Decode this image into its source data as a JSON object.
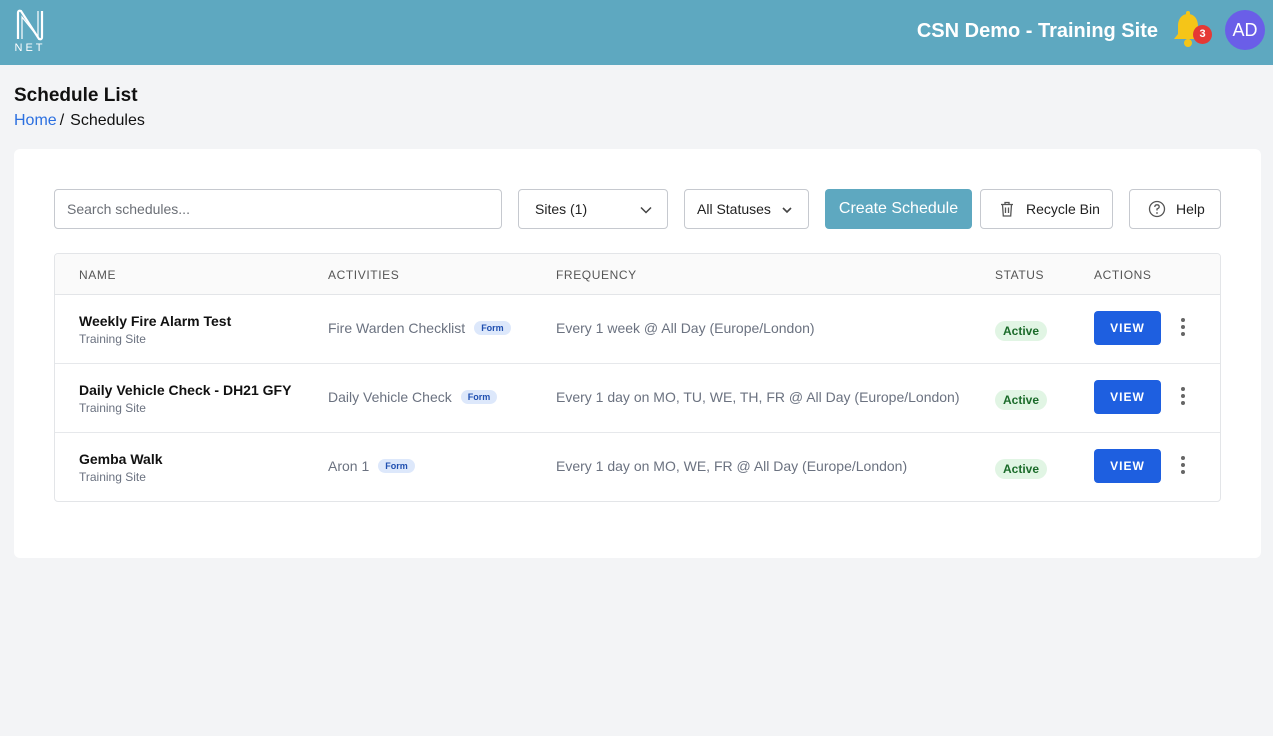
{
  "header": {
    "logo_text": "NET",
    "site_title": "CSN Demo - Training Site",
    "notification_count": "3",
    "avatar_initials": "AD"
  },
  "page": {
    "title": "Schedule List",
    "breadcrumb": {
      "home": "Home",
      "separator": "/",
      "current": "Schedules"
    }
  },
  "toolbar": {
    "search_placeholder": "Search schedules...",
    "sites_filter": "Sites (1)",
    "status_filter": "All Statuses",
    "create_label": "Create Schedule",
    "recycle_label": "Recycle Bin",
    "help_label": "Help"
  },
  "table": {
    "columns": [
      "NAME",
      "ACTIVITIES",
      "FREQUENCY",
      "STATUS",
      "ACTIONS"
    ],
    "rows": [
      {
        "name": "Weekly Fire Alarm Test",
        "site": "Training Site",
        "activity": "Fire Warden Checklist",
        "activity_tag": "Form",
        "frequency": "Every 1 week @ All Day (Europe/London)",
        "status": "Active",
        "action": "VIEW"
      },
      {
        "name": "Daily Vehicle Check - DH21 GFY",
        "site": "Training Site",
        "activity": "Daily Vehicle Check",
        "activity_tag": "Form",
        "frequency": "Every 1 day on MO, TU, WE, TH, FR @ All Day (Europe/London)",
        "status": "Active",
        "action": "VIEW"
      },
      {
        "name": "Gemba Walk",
        "site": "Training Site",
        "activity": "Aron 1",
        "activity_tag": "Form",
        "frequency": "Every 1 day on MO, WE, FR @ All Day (Europe/London)",
        "status": "Active",
        "action": "VIEW"
      }
    ]
  },
  "colors": {
    "header_bg": "#5ea8c0",
    "primary_button": "#1e5fe0",
    "status_active_bg": "#e1f5e4",
    "badge": "#e53935",
    "avatar": "#6a5ee8"
  },
  "icons": [
    "logo-icon",
    "bell-icon",
    "chevron-down-icon",
    "trash-icon",
    "help-circle-icon",
    "more-vertical-icon"
  ]
}
